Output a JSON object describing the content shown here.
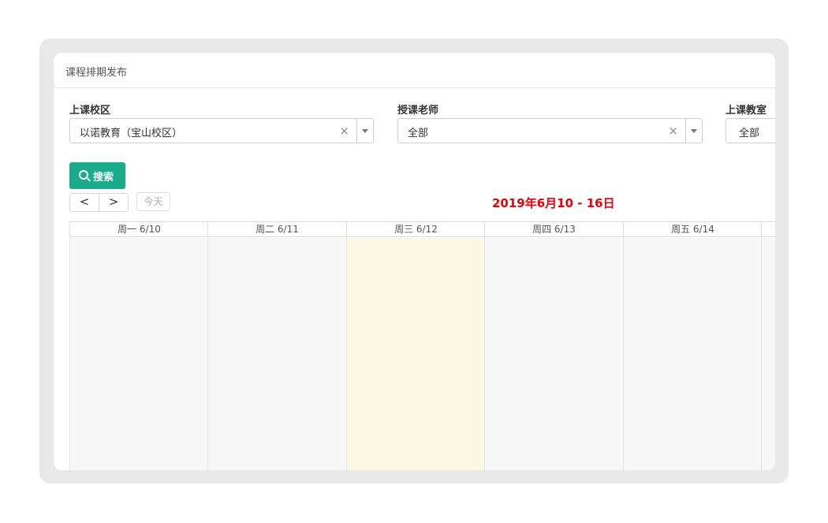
{
  "panel": {
    "title": "课程排期发布"
  },
  "filters": {
    "campus": {
      "label": "上课校区",
      "value": "以诺教育（宝山校区）",
      "clear": "×"
    },
    "teacher": {
      "label": "授课老师",
      "value": "全部",
      "clear": "×"
    },
    "classroom": {
      "label": "上课教室",
      "value": "全部"
    }
  },
  "search_button": {
    "label": "搜索",
    "icon": "search-icon"
  },
  "nav": {
    "prev": "<",
    "next": ">",
    "today": "今天"
  },
  "range_title": "2019年6月10 - 16日",
  "colors": {
    "accent": "#1aab8c",
    "range_title": "#e8000b",
    "today_column": "#fcf8e3"
  },
  "calendar": {
    "days": [
      {
        "label": "周一 6/10",
        "today": false
      },
      {
        "label": "周二 6/11",
        "today": false
      },
      {
        "label": "周三 6/12",
        "today": true
      },
      {
        "label": "周四 6/13",
        "today": false
      },
      {
        "label": "周五 6/14",
        "today": false
      }
    ]
  }
}
